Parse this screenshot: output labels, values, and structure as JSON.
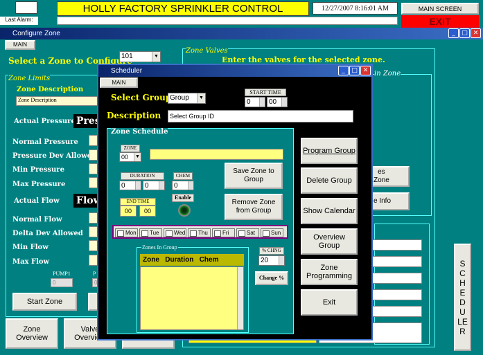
{
  "header": {
    "title": "HOLLY FACTORY SPRINKLER CONTROL",
    "datetime": "12/27/2007  8:16:01 AM",
    "main_screen": "MAIN SCREEN",
    "exit": "EXIT",
    "last_alarm": "Last Alarm:"
  },
  "configure_zone": {
    "title": "Configure Zone",
    "main_tab": "MAIN",
    "select_zone_label": "Select a Zone to Configure",
    "zone_value": "101",
    "zone_limits": "Zone Limits",
    "zone_description": "Zone Description",
    "zone_description_value": "Zone Description",
    "actual_pressure": "Actual Pressure",
    "pressure_value": "Pres",
    "normal_flow_header": "Normal Pressure",
    "pressure_dev": "Pressure Dev Allowed",
    "min_pressure": "Min Pressure",
    "max_pressure": "Max Pressure",
    "actual_flow": "Actual Flow",
    "flow_value": "Flow",
    "normal_flow": "Normal Flow",
    "delta_dev": "Delta Dev Allowed",
    "min_flow": "Min Flow",
    "max_flow": "Max Flow",
    "pump1": "PUMP1",
    "pump1_value": "0",
    "pump2_value": "0",
    "pump2_prefix": "P",
    "start_zone": "Start Zone",
    "zone_overview": "Zone Overview",
    "valve_overview": "Valve Overview",
    "zone_valves": "Zone Valves",
    "valves_instruction": "Enter the valves for the selected zone.",
    "in_zone": "in Zone",
    "es_zone": "es\nZone",
    "e_info": "e Info",
    "scheduler_side": "SC HE DU LER"
  },
  "scheduler": {
    "title": "Scheduler",
    "main_tab": "MAIN",
    "select_group": "Select Group",
    "group_value": "Group",
    "start_time": "START TIME",
    "start_hour": "0",
    "start_min": "00",
    "description": "Description",
    "description_value": "Select Group ID",
    "zone_schedule": "Zone Schedule",
    "zone_label": "ZONE",
    "zone_value": "00",
    "duration": "DURATION",
    "dur_min": "0",
    "dur_sec": "0",
    "chem": "CHEM",
    "chem_value": "0",
    "end_time": "END TIME",
    "end_hour": "00",
    "end_min": "00",
    "enable": "Enable",
    "save_zone": "Save Zone to Group",
    "remove_zone": "Remove Zone from Group",
    "days": [
      "Mon",
      "Tue",
      "Wed",
      "Thu",
      "Fri",
      "Sat",
      "Sun"
    ],
    "zones_in_group": "Zones In Group",
    "col_zone": "Zone",
    "col_duration": "Duration",
    "col_chem": "Chem",
    "pct_chng": "% CHNG",
    "pct_value": "20",
    "change_pct": "Change %",
    "program_group": "Program Group",
    "delete_group": "Delete Group",
    "show_calendar": "Show Calendar",
    "overview_group": "Overview Group",
    "zone_programming": "Zone Programming",
    "exit": "Exit"
  }
}
